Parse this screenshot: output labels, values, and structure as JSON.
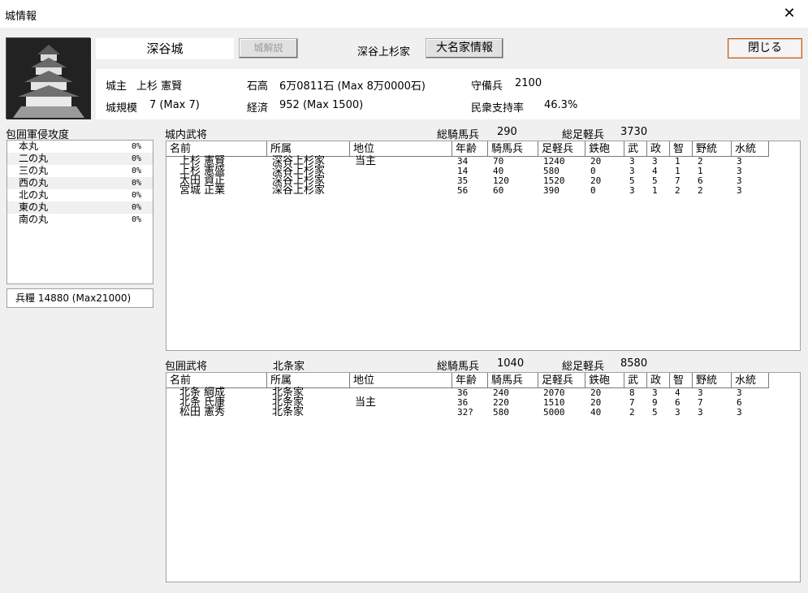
{
  "window": {
    "title": "城情報",
    "close_glyph": "✕"
  },
  "castle": {
    "name": "深谷城",
    "explain_button": "城解説",
    "clan": "深谷上杉家",
    "daimyo_button": "大名家情報",
    "close_button": "閉じる"
  },
  "info": {
    "lord_label": "城主",
    "lord_value": "上杉 憲賢",
    "kokudaka_label": "石高",
    "kokudaka_value": "6万0811石 (Max 8万0000石)",
    "garrison_label": "守備兵",
    "garrison_value": "2100",
    "scale_label": "城規模",
    "scale_value": "7 (Max 7)",
    "economy_label": "経済",
    "economy_value": "952 (Max 1500)",
    "support_label": "民衆支持率",
    "support_value": "46.3%"
  },
  "siege": {
    "title": "包囲軍侵攻度",
    "rows": [
      {
        "name": "本丸",
        "pct": "0%"
      },
      {
        "name": "二の丸",
        "pct": "0%"
      },
      {
        "name": "三の丸",
        "pct": "0%"
      },
      {
        "name": "西の丸",
        "pct": "0%"
      },
      {
        "name": "北の丸",
        "pct": "0%"
      },
      {
        "name": "東の丸",
        "pct": "0%"
      },
      {
        "name": "南の丸",
        "pct": "0%"
      }
    ],
    "rations": "兵糧 14880 (Max21000)"
  },
  "columns": [
    "名前",
    "所属",
    "地位",
    "年齢",
    "騎馬兵",
    "足軽兵",
    "鉄砲",
    "武",
    "政",
    "智",
    "野統",
    "水統"
  ],
  "inner": {
    "title": "城内武将",
    "clan": "",
    "cav_label": "総騎馬兵",
    "cav_value": "290",
    "foot_label": "総足軽兵",
    "foot_value": "3730",
    "rows": [
      [
        "上杉 憲賢",
        "深谷上杉家",
        "当主",
        "34",
        "70",
        "1240",
        "20",
        "3",
        "3",
        "1",
        "2",
        "3"
      ],
      [
        "上杉 憲盛",
        "深谷上杉家",
        "",
        "14",
        "40",
        "580",
        "0",
        "3",
        "4",
        "1",
        "1",
        "3"
      ],
      [
        "太田 資正",
        "深谷上杉家",
        "",
        "35",
        "120",
        "1520",
        "20",
        "5",
        "5",
        "7",
        "6",
        "3"
      ],
      [
        "宮城 正業",
        "深谷上杉家",
        "",
        "56",
        "60",
        "390",
        "0",
        "3",
        "1",
        "2",
        "2",
        "3"
      ]
    ]
  },
  "besiege": {
    "title": "包囲武将",
    "clan": "北条家",
    "cav_label": "総騎馬兵",
    "cav_value": "1040",
    "foot_label": "総足軽兵",
    "foot_value": "8580",
    "rows": [
      [
        "北条 綱成",
        "北条家",
        "",
        "36",
        "240",
        "2070",
        "20",
        "8",
        "3",
        "4",
        "3",
        "3"
      ],
      [
        "北条 氏康",
        "北条家",
        "当主",
        "36",
        "220",
        "1510",
        "20",
        "7",
        "9",
        "6",
        "7",
        "6"
      ],
      [
        "松田 憲秀",
        "北条家",
        "",
        "32?",
        "580",
        "5000",
        "40",
        "2",
        "5",
        "3",
        "3",
        "3"
      ]
    ]
  }
}
